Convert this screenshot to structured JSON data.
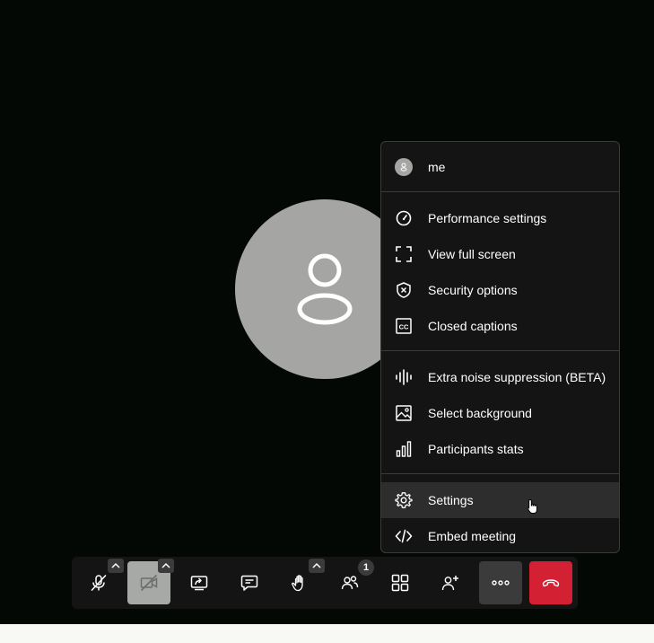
{
  "menu": {
    "user_name": "me",
    "items": [
      {
        "label": "Performance settings",
        "icon": "gauge-icon"
      },
      {
        "label": "View full screen",
        "icon": "fullscreen-icon"
      },
      {
        "label": "Security options",
        "icon": "shield-icon"
      },
      {
        "label": "Closed captions",
        "icon": "closed-captions-icon"
      },
      {
        "label": "Extra noise suppression (BETA)",
        "icon": "waveform-icon"
      },
      {
        "label": "Select background",
        "icon": "image-icon"
      },
      {
        "label": "Participants stats",
        "icon": "bar-chart-icon"
      },
      {
        "label": "Settings",
        "icon": "gear-icon"
      },
      {
        "label": "Embed meeting",
        "icon": "code-icon"
      }
    ]
  },
  "toolbar": {
    "participants_count": "1"
  },
  "colors": {
    "stage_bg": "#040804",
    "menu_bg": "#141414",
    "hover_bg": "#2d2d2d",
    "avatar_gray": "#a5a6a3",
    "hangup_red": "#d42033"
  }
}
